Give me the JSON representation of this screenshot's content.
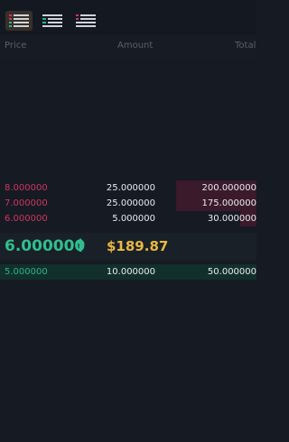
{
  "view_toggle": {
    "items": [
      {
        "name": "both",
        "active": true
      },
      {
        "name": "bids",
        "active": false
      },
      {
        "name": "asks",
        "active": false
      }
    ]
  },
  "header": {
    "price": "Price",
    "amount": "Amount",
    "total": "Total"
  },
  "asks": [
    {
      "price": "8.000000",
      "amount": "25.000000",
      "total": "200.000000",
      "depth": 0.39
    },
    {
      "price": "7.000000",
      "amount": "25.000000",
      "total": "175.000000",
      "depth": 0.39
    },
    {
      "price": "6.000000",
      "amount": "5.000000",
      "total": "30.000000",
      "depth": 0.08
    }
  ],
  "mid": {
    "price": "6.000000",
    "usd": "$189.87",
    "direction": "up"
  },
  "bids": [
    {
      "price": "5.000000",
      "amount": "10.000000",
      "total": "50.000000",
      "depth": 1.0
    }
  ],
  "colors": {
    "ask": "#d0365e",
    "bid": "#2fb18b",
    "ask_depth": "#3a1a2b",
    "bid_depth": "#12302b",
    "mid_price": "#2fbf8f",
    "usd": "#e8b840",
    "active_toggle": "#37302a"
  }
}
